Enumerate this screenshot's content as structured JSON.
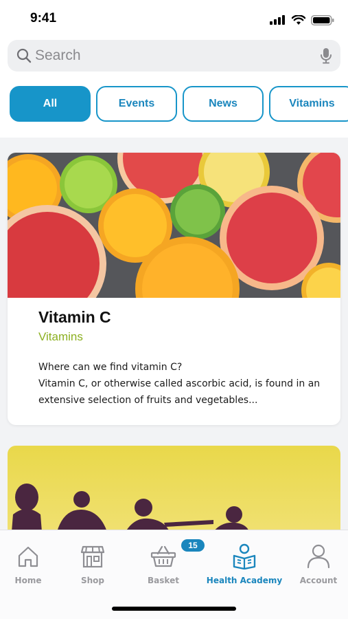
{
  "status_bar": {
    "time": "9:41"
  },
  "search": {
    "placeholder": "Search"
  },
  "filters": [
    {
      "label": "All",
      "active": true
    },
    {
      "label": "Events",
      "active": false
    },
    {
      "label": "News",
      "active": false
    },
    {
      "label": "Vitamins",
      "active": false
    }
  ],
  "articles": [
    {
      "title": "Vitamin C",
      "category": "Vitamins",
      "excerpt_line1": "Where can we find vitamin C?",
      "excerpt_line2": "Vitamin C, or otherwise called ascorbic acid, is found in an extensive selection of fruits and  vegetables..."
    }
  ],
  "tabbar": {
    "items": [
      {
        "label": "Home",
        "icon": "home-icon"
      },
      {
        "label": "Shop",
        "icon": "shop-icon"
      },
      {
        "label": "Basket",
        "icon": "basket-icon"
      },
      {
        "label": "Health Academy",
        "icon": "book-reader-icon",
        "active": true
      },
      {
        "label": "Account",
        "icon": "user-icon"
      }
    ],
    "basket_count": "15"
  },
  "colors": {
    "accent": "#1795c9",
    "category": "#8cb021",
    "inactive_tab": "#9a9a9e"
  }
}
